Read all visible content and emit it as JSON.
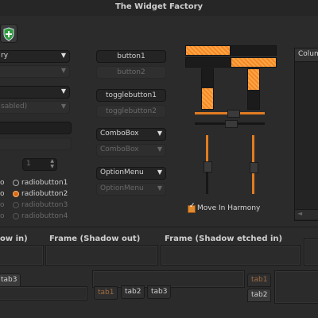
{
  "window": {
    "title": "The Widget Factory"
  },
  "toolbar": {
    "icon": "add-shield-icon"
  },
  "left_combos": [
    {
      "text": "ry"
    },
    {
      "text": ""
    },
    {
      "text": ""
    },
    {
      "text": "sabled)"
    }
  ],
  "spin": {
    "value": "1"
  },
  "radios": [
    {
      "label": "radiobutton1",
      "checked": false,
      "disabled": false
    },
    {
      "label": "radiobutton2",
      "checked": true,
      "disabled": false
    },
    {
      "label": "radiobutton3",
      "checked": false,
      "disabled": true
    },
    {
      "label": "radiobutton4",
      "checked": false,
      "disabled": true
    }
  ],
  "left_radio_fragments": [
    "o",
    "o",
    "o",
    "o"
  ],
  "middle": {
    "button1": "button1",
    "button2": "button2",
    "toggle1": "togglebutton1",
    "toggle2": "togglebutton2",
    "combobox": "ComboBox",
    "combobox_dis": "ComboBox",
    "optionmenu": "OptionMenu",
    "optionmenu_dis": "OptionMenu"
  },
  "move_in_harmony": {
    "label": "Move In Harmony",
    "checked": true
  },
  "right_list": {
    "column": "Colum"
  },
  "frames": {
    "frame1": "ow in)",
    "frame2": "Frame (Shadow out)",
    "frame3": "Frame (Shadow etched in)"
  },
  "tabs_left": {
    "tab3": "tab3"
  },
  "tabs_middle": [
    {
      "label": "tab1"
    },
    {
      "label": "tab2"
    },
    {
      "label": "tab3"
    }
  ],
  "tabs_right": [
    {
      "label": "tab1"
    },
    {
      "label": "tab2"
    }
  ]
}
